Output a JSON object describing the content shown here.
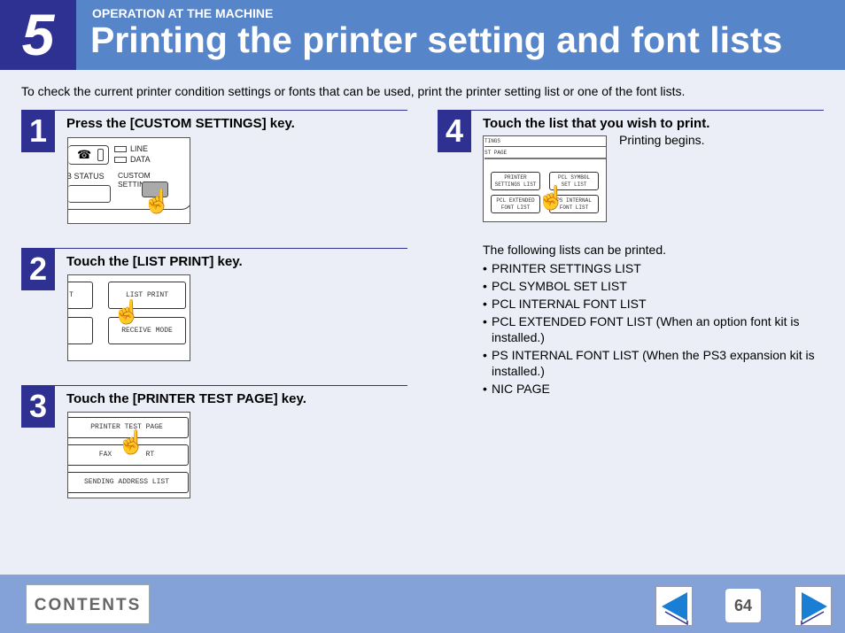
{
  "header": {
    "chapter_number": "5",
    "section": "OPERATION AT THE MACHINE",
    "title": "Printing the printer setting and font lists"
  },
  "intro": "To check the current printer condition settings or fonts that can be used, print the printer setting list or one of the font lists.",
  "steps": [
    {
      "number": "1",
      "title": "Press the [CUSTOM SETTINGS] key.",
      "panel": {
        "line": "LINE",
        "data": "DATA",
        "status": "B STATUS",
        "custom": "CUSTOM SETTINGS"
      }
    },
    {
      "number": "2",
      "title": "Touch the [LIST PRINT] key.",
      "panel": {
        "list_print": "LIST PRINT",
        "receive_mode": "RECEIVE MODE",
        "left_partial": "T"
      }
    },
    {
      "number": "3",
      "title": "Touch the [PRINTER TEST PAGE] key.",
      "panel": {
        "test_page": "PRINTER TEST PAGE",
        "fax": "FAX        RT",
        "sending": "SENDING ADDRESS LIST"
      }
    },
    {
      "number": "4",
      "title": "Touch the list that you wish to print.",
      "note": "Printing begins.",
      "panel": {
        "row1": "TINGS",
        "row2": "ST PAGE",
        "btn1": [
          "PRINTER",
          "SETTINGS LIST"
        ],
        "btn2": [
          "PCL SYMBOL",
          "SET LIST"
        ],
        "btn3": [
          "PCL EXTENDED",
          "FONT LIST"
        ],
        "btn4": [
          "PS INTERNAL",
          "FONT LIST"
        ]
      }
    }
  ],
  "lists": {
    "heading": "The following lists can be printed.",
    "items": [
      "PRINTER SETTINGS LIST",
      "PCL SYMBOL SET LIST",
      "PCL INTERNAL FONT LIST",
      "PCL EXTENDED FONT LIST (When an option font kit is installed.)",
      "PS INTERNAL FONT LIST (When the PS3 expansion kit is installed.)",
      "NIC PAGE"
    ]
  },
  "footer": {
    "contents_label": "CONTENTS",
    "page_number": "64",
    "prev_icon": "left-arrow",
    "next_icon": "right-arrow",
    "arrow_color": "#1a7fd4"
  }
}
